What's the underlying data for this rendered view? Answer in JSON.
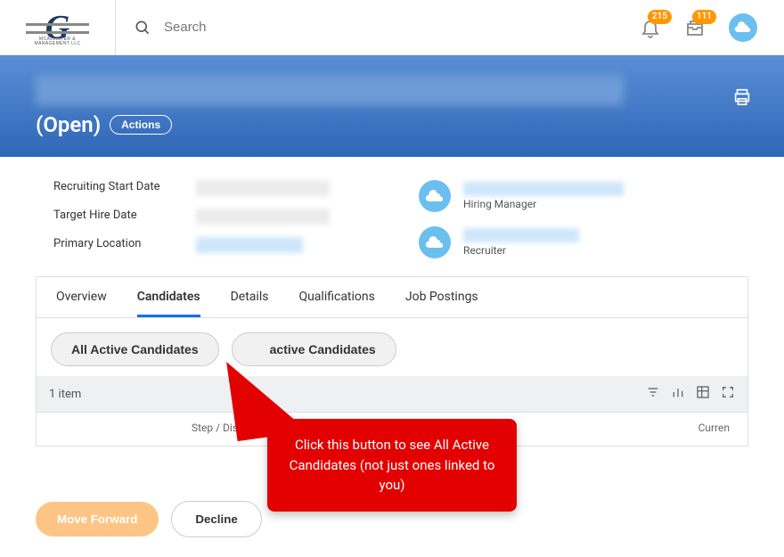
{
  "header": {
    "search_placeholder": "Search",
    "notif_badge": "215",
    "inbox_badge": "111"
  },
  "page": {
    "status_label": "(Open)",
    "actions_label": "Actions"
  },
  "details": {
    "recruiting_start_label": "Recruiting Start Date",
    "target_hire_label": "Target Hire Date",
    "primary_location_label": "Primary Location",
    "hiring_manager_label": "Hiring Manager",
    "recruiter_label": "Recruiter"
  },
  "tabs": {
    "overview": "Overview",
    "candidates": "Candidates",
    "details": "Details",
    "qualifications": "Qualifications",
    "job_postings": "Job Postings"
  },
  "filters": {
    "all_active": "All Active Candidates",
    "inactive_partial": "active Candidates"
  },
  "table": {
    "item_count": "1 item",
    "col_step": "Step / Dis",
    "col_current": "Curren"
  },
  "actions": {
    "move_forward": "Move Forward",
    "decline": "Decline"
  },
  "callout": {
    "text": "Click this button to see All Active Candidates (not just ones linked to you)"
  }
}
